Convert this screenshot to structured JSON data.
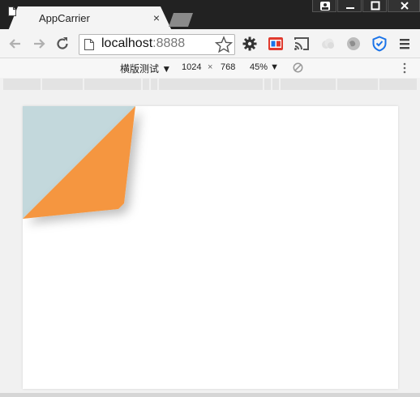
{
  "tab": {
    "title": "AppCarrier",
    "close": "×",
    "favicon_icon": "page-icon"
  },
  "address": {
    "host": "localhost",
    "port": ":8888"
  },
  "device_toolbar": {
    "mode_label": "横版测试",
    "width": "1024",
    "times": "×",
    "height": "768",
    "zoom": "45%",
    "dropdown_icon": "caret-down-icon"
  },
  "colors": {
    "fold_back": "#c3d8dc",
    "fold_front": "#f5963f",
    "extension_blue": "#1a73e8",
    "extension_red": "#e03a2e"
  }
}
